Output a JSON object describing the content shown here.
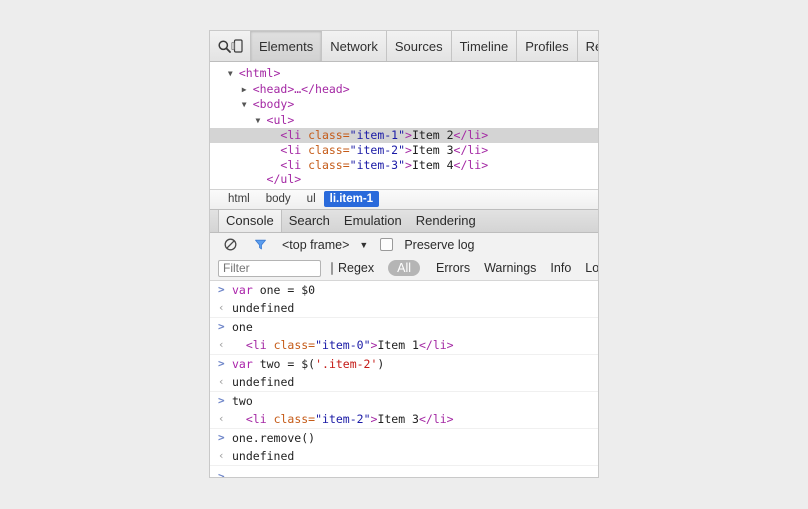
{
  "window": {
    "title": "Chrome DevTools"
  },
  "main_toolbar": {
    "search_icon": "search-icon",
    "device_icon": "device-toggle-icon",
    "tabs": [
      {
        "label": "Elements",
        "active": true
      },
      {
        "label": "Network",
        "active": false
      },
      {
        "label": "Sources",
        "active": false
      },
      {
        "label": "Timeline",
        "active": false
      },
      {
        "label": "Profiles",
        "active": false
      },
      {
        "label": "Resou",
        "active": false
      }
    ]
  },
  "dom_tree": {
    "rows": [
      {
        "indent": 0,
        "twisty": "▼",
        "segments": [
          {
            "t": "tag",
            "v": "<html>"
          }
        ],
        "selected": false
      },
      {
        "indent": 1,
        "twisty": "▶",
        "segments": [
          {
            "t": "tag",
            "v": "<head>…</head>"
          }
        ],
        "selected": false
      },
      {
        "indent": 1,
        "twisty": "▼",
        "segments": [
          {
            "t": "tag",
            "v": "<body>"
          }
        ],
        "selected": false
      },
      {
        "indent": 2,
        "twisty": "▼",
        "segments": [
          {
            "t": "tag",
            "v": "<ul>"
          }
        ],
        "selected": false
      },
      {
        "indent": 3,
        "twisty": "",
        "segments": [
          {
            "t": "tag",
            "v": "<li "
          },
          {
            "t": "attr",
            "v": "class="
          },
          {
            "t": "val",
            "v": "\"item-1\""
          },
          {
            "t": "tag",
            "v": ">"
          },
          {
            "t": "txt",
            "v": "Item 2"
          },
          {
            "t": "tag",
            "v": "</li>"
          }
        ],
        "selected": true
      },
      {
        "indent": 3,
        "twisty": "",
        "segments": [
          {
            "t": "tag",
            "v": "<li "
          },
          {
            "t": "attr",
            "v": "class="
          },
          {
            "t": "val",
            "v": "\"item-2\""
          },
          {
            "t": "tag",
            "v": ">"
          },
          {
            "t": "txt",
            "v": "Item 3"
          },
          {
            "t": "tag",
            "v": "</li>"
          }
        ],
        "selected": false
      },
      {
        "indent": 3,
        "twisty": "",
        "segments": [
          {
            "t": "tag",
            "v": "<li "
          },
          {
            "t": "attr",
            "v": "class="
          },
          {
            "t": "val",
            "v": "\"item-3\""
          },
          {
            "t": "tag",
            "v": ">"
          },
          {
            "t": "txt",
            "v": "Item 4"
          },
          {
            "t": "tag",
            "v": "</li>"
          }
        ],
        "selected": false
      },
      {
        "indent": 2,
        "twisty": "",
        "segments": [
          {
            "t": "tag",
            "v": "</ul>"
          }
        ],
        "selected": false
      }
    ]
  },
  "breadcrumb": {
    "items": [
      {
        "label": "html",
        "active": false
      },
      {
        "label": "body",
        "active": false
      },
      {
        "label": "ul",
        "active": false
      },
      {
        "label": "li.item-1",
        "active": true
      }
    ]
  },
  "drawer": {
    "tabs": [
      {
        "label": "Console",
        "active": true
      },
      {
        "label": "Search",
        "active": false
      },
      {
        "label": "Emulation",
        "active": false
      },
      {
        "label": "Rendering",
        "active": false
      }
    ]
  },
  "console_toolbar": {
    "clear_icon": "clear-console-icon",
    "filter_icon": "filter-funnel-icon",
    "context": "<top frame>",
    "context_caret": "▼",
    "preserve_log_label": "Preserve log",
    "preserve_log_checked": false
  },
  "filter_bar": {
    "filter_placeholder": "Filter",
    "filter_value": "",
    "regex_label": "Regex",
    "regex_checked": false,
    "levels": [
      {
        "label": "All",
        "active": true
      },
      {
        "label": "Errors",
        "active": false
      },
      {
        "label": "Warnings",
        "active": false
      },
      {
        "label": "Info",
        "active": false
      },
      {
        "label": "Lo",
        "active": false
      }
    ]
  },
  "console": {
    "messages": [
      {
        "kind": "input",
        "arrow": ">",
        "segments": [
          {
            "t": "kw",
            "v": "var"
          },
          {
            "t": "plain",
            "v": " one = $0"
          }
        ]
      },
      {
        "kind": "output",
        "arrow": "‹",
        "segments": [
          {
            "t": "plain",
            "v": "undefined"
          }
        ]
      },
      {
        "kind": "input",
        "arrow": ">",
        "segments": [
          {
            "t": "plain",
            "v": "one"
          }
        ],
        "group_start": true
      },
      {
        "kind": "output",
        "arrow": "‹",
        "segments": [
          {
            "t": "plain",
            "v": "  "
          },
          {
            "t": "tag",
            "v": "<li "
          },
          {
            "t": "attr",
            "v": "class="
          },
          {
            "t": "val",
            "v": "\"item-0\""
          },
          {
            "t": "tag",
            "v": ">"
          },
          {
            "t": "txt",
            "v": "Item 1"
          },
          {
            "t": "tag",
            "v": "</li>"
          }
        ]
      },
      {
        "kind": "input",
        "arrow": ">",
        "segments": [
          {
            "t": "kw",
            "v": "var"
          },
          {
            "t": "plain",
            "v": " two = $("
          },
          {
            "t": "str",
            "v": "'.item-2'"
          },
          {
            "t": "plain",
            "v": ")"
          }
        ],
        "group_start": true
      },
      {
        "kind": "output",
        "arrow": "‹",
        "segments": [
          {
            "t": "plain",
            "v": "undefined"
          }
        ]
      },
      {
        "kind": "input",
        "arrow": ">",
        "segments": [
          {
            "t": "plain",
            "v": "two"
          }
        ],
        "group_start": true
      },
      {
        "kind": "output",
        "arrow": "‹",
        "segments": [
          {
            "t": "plain",
            "v": "  "
          },
          {
            "t": "tag",
            "v": "<li "
          },
          {
            "t": "attr",
            "v": "class="
          },
          {
            "t": "val",
            "v": "\"item-2\""
          },
          {
            "t": "tag",
            "v": ">"
          },
          {
            "t": "txt",
            "v": "Item 3"
          },
          {
            "t": "tag",
            "v": "</li>"
          }
        ]
      },
      {
        "kind": "input",
        "arrow": ">",
        "segments": [
          {
            "t": "plain",
            "v": "one.remove()"
          }
        ],
        "group_start": true
      },
      {
        "kind": "output",
        "arrow": "‹",
        "segments": [
          {
            "t": "plain",
            "v": "undefined"
          }
        ]
      }
    ],
    "prompt_arrow": ">",
    "prompt_value": ""
  },
  "colors": {
    "selection_blue": "#2a6adb",
    "tag_magenta": "#a428a4",
    "attr_orange": "#c55b18",
    "value_blue": "#1a1aa6",
    "string_red": "#c41a16",
    "keyword_purple": "#aa22aa",
    "page_background": "#ededed"
  }
}
